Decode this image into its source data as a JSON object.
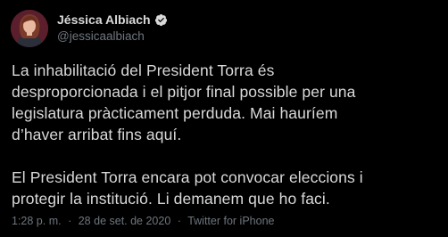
{
  "author": {
    "display_name": "Jéssica Albiach",
    "handle": "@jessicaalbiach",
    "verified": true,
    "verified_color": "#d9d9d9"
  },
  "tweet": {
    "paragraph1": [
      "La inhabilitació del President Torra és",
      "desproporcionada i el pitjor final possible per una",
      "legislatura pràcticament perduda. Mai hauríem",
      "d’haver arribat fins aquí."
    ],
    "paragraph2": [
      "El President Torra encara pot convocar eleccions i",
      "protegir la institució. Li demanem que ho faci."
    ]
  },
  "meta": {
    "time": "1:28 p. m.",
    "separator": "·",
    "date": "28 de set. de 2020",
    "source": "Twitter for iPhone"
  },
  "colors": {
    "background": "#000000",
    "text": "#d9d9d9",
    "muted": "#6e767d"
  }
}
